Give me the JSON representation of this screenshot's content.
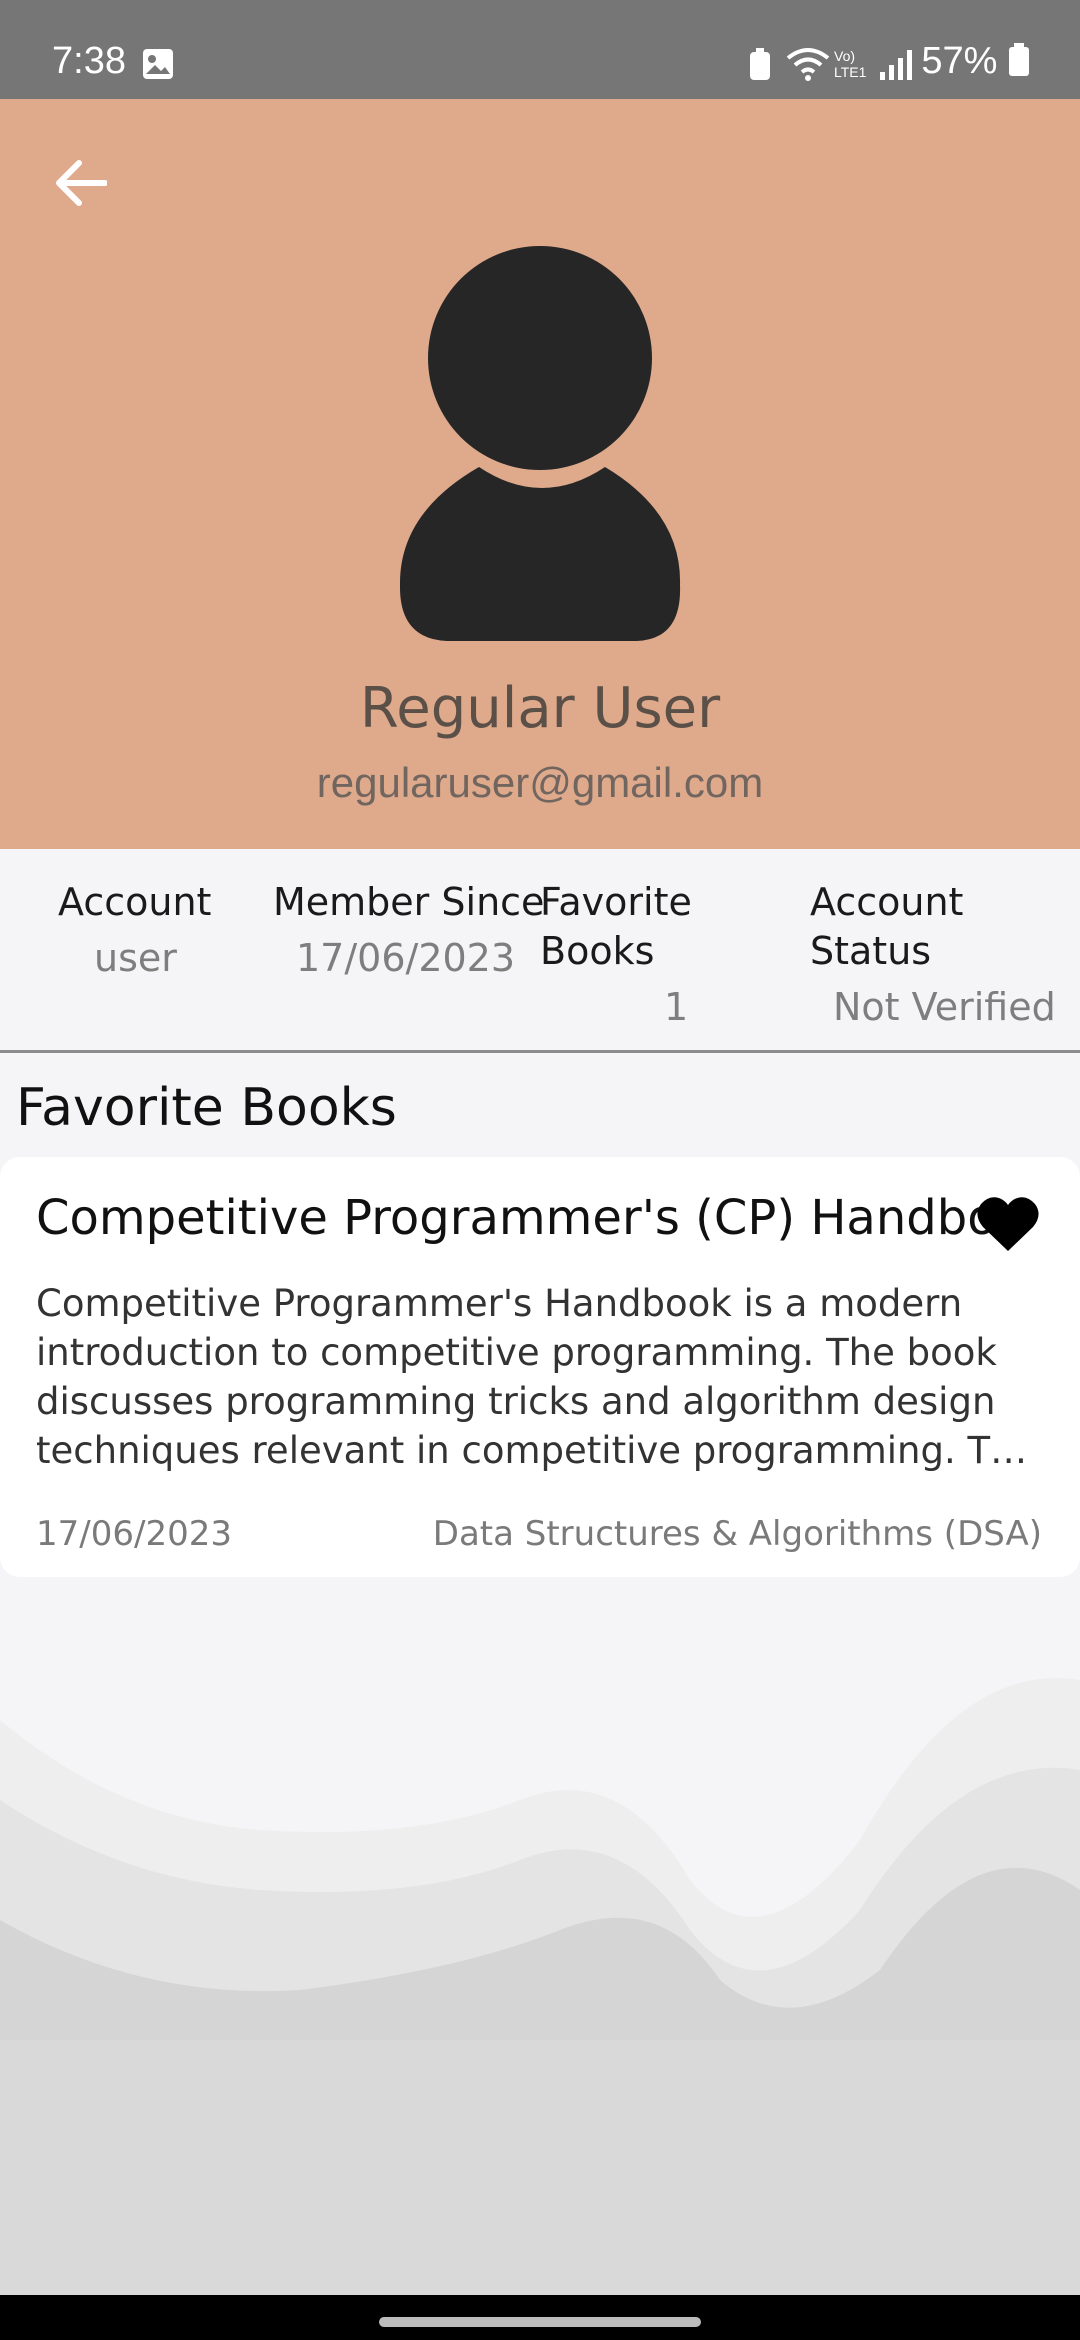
{
  "status_bar": {
    "time": "7:38",
    "network": "Vo) LTE1",
    "battery": "57%"
  },
  "header": {
    "background_color": "#dfa98c",
    "back_icon": "arrow-left-icon",
    "avatar_icon": "person-icon",
    "user_name": "Regular User",
    "user_email": "regularuser@gmail.com"
  },
  "stats": {
    "account_label": "Account",
    "account_value": "user",
    "member_since_label": "Member Since",
    "member_since_value": "17/06/2023",
    "favorite_books_label_line1": "Favorite",
    "favorite_books_label_line2": "Books",
    "favorite_books_value": "1",
    "account_status_label_line1": "Account",
    "account_status_label_line2": "Status",
    "account_status_value": "Not Verified"
  },
  "favorites": {
    "section_title": "Favorite Books",
    "books": [
      {
        "title": "Competitive Programmer's (CP) Handbook",
        "description": "Competitive Programmer's Handbook is a modern introduction to competitive programming. The book discusses programming tricks and algorithm design techniques relevant in competitive programming. T…",
        "date": "17/06/2023",
        "category": "Data Structures & Algorithms (DSA)",
        "favorite_icon": "heart-icon"
      }
    ]
  }
}
